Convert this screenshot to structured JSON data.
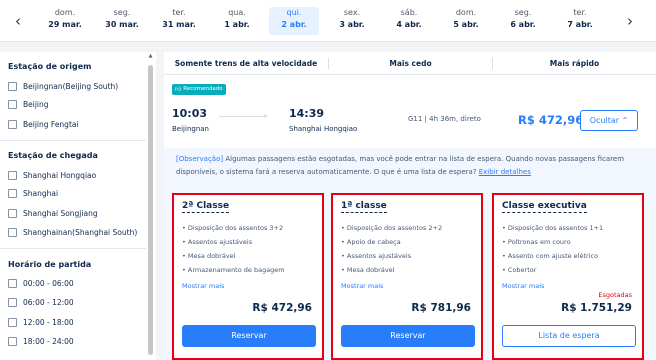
{
  "date_nav": {
    "prev_icon": "chevron-left-icon",
    "next_icon": "chevron-right-icon",
    "dates": [
      {
        "day": "dom.",
        "date": "29 mar.",
        "active": false
      },
      {
        "day": "seg.",
        "date": "30 mar.",
        "active": false
      },
      {
        "day": "ter.",
        "date": "31 mar.",
        "active": false
      },
      {
        "day": "qua.",
        "date": "1 abr.",
        "active": false
      },
      {
        "day": "qui.",
        "date": "2 abr.",
        "active": true
      },
      {
        "day": "sex.",
        "date": "3 abr.",
        "active": false
      },
      {
        "day": "sáb.",
        "date": "4 abr.",
        "active": false
      },
      {
        "day": "dom.",
        "date": "5 abr.",
        "active": false
      },
      {
        "day": "seg.",
        "date": "6 abr.",
        "active": false
      },
      {
        "day": "ter.",
        "date": "7 abr.",
        "active": false
      }
    ]
  },
  "sidebar": {
    "origin": {
      "title": "Estação de origem",
      "items": [
        "Beijingnan(Beijing South)",
        "Beijing",
        "Beijing Fengtai"
      ]
    },
    "arrival": {
      "title": "Estação de chegada",
      "items": [
        "Shanghai Hongqiao",
        "Shanghai",
        "Shanghai Songjiang",
        "Shanghainan(Shanghai South)"
      ]
    },
    "departure_time": {
      "title": "Horário de partida",
      "items": [
        "00:00 - 06:00",
        "06:00 - 12:00",
        "12:00 - 18:00",
        "18:00 - 24:00"
      ]
    }
  },
  "tabs": [
    "Somente trens de alta velocidade",
    "Mais cedo",
    "Mais rápido"
  ],
  "train": {
    "badge": "Recomendado",
    "badge_icon": "thumbs-up-icon",
    "dep_time": "10:03",
    "dep_station": "Beijingnan",
    "arr_time": "14:39",
    "arr_station": "Shanghai Hongqiao",
    "info": "G11 | 4h 36m, direto",
    "price": "R$ 472,96",
    "hide_label": "Ocultar",
    "hide_icon": "chevron-up-icon"
  },
  "observation": {
    "tag": "[Observação]",
    "text": " Algumas passagens estão esgotadas, mas você pode entrar na lista de espera. Quando novas passagens ficarem disponíveis, o sistema fará a reserva automaticamente. O que é uma lista de espera? ",
    "link": "Exibir detalhes"
  },
  "classes": [
    {
      "name": "2ª Classe",
      "features": [
        "• Disposição dos assentos 3+2",
        "• Assentos ajustáveis",
        "• Mesa dobrável",
        "• Armazenamento de bagagem"
      ],
      "more": "Mostrar mais",
      "status": "",
      "price": "R$ 472,96",
      "button": "Reservar"
    },
    {
      "name": "1ª classe",
      "features": [
        "• Disposição dos assentos 2+2",
        "• Apoio de cabeça",
        "• Assentos ajustáveis",
        "• Mesa dobrável"
      ],
      "more": "Mostrar mais",
      "status": "",
      "price": "R$ 781,96",
      "button": "Reservar"
    },
    {
      "name": "Classe executiva",
      "features": [
        "• Disposição dos assentos 1+1",
        "• Poltronas em couro",
        "• Assento com ajuste elétrico",
        "• Cobertor"
      ],
      "more": "Mostrar mais",
      "status": "Esgotadas",
      "price": "R$ 1.751,29",
      "button": "Lista de espera"
    }
  ],
  "colors": {
    "accent": "#287dfa",
    "highlight_border": "#e60012",
    "badge": "#06aebd",
    "text": "#0f294d"
  }
}
